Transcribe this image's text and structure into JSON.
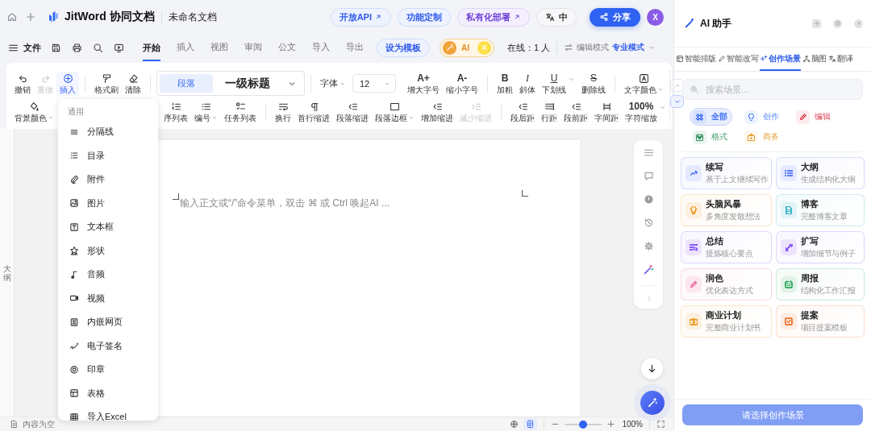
{
  "top_bar": {
    "app_name": "JitWord 协同文档",
    "doc_title": "未命名文档",
    "pills": [
      {
        "label": "开放API",
        "kind": "link"
      },
      {
        "label": "功能定制",
        "kind": "plain"
      },
      {
        "label": "私有化部署",
        "kind": "premium"
      }
    ],
    "language": "中",
    "share": "分享",
    "avatar": "X"
  },
  "menu_bar": {
    "file": "文件",
    "tabs": [
      {
        "label": "开始",
        "selected": true
      },
      {
        "label": "插入",
        "selected": false
      },
      {
        "label": "视图",
        "selected": false
      },
      {
        "label": "审阅",
        "selected": false
      },
      {
        "label": "公文",
        "selected": false
      },
      {
        "label": "导入",
        "selected": false
      },
      {
        "label": "导出",
        "selected": false
      }
    ],
    "template": "设为模板",
    "ai": {
      "label": "AI",
      "badge": "X"
    },
    "online": "在线：1 人",
    "mode_label": "编辑模式",
    "mode_value": "专业模式"
  },
  "toolbar": {
    "rows": [
      {
        "items": [
          {
            "kind": "button",
            "label": "撤销",
            "disabled": false,
            "active": false
          },
          {
            "kind": "button",
            "label": "重做",
            "disabled": true,
            "active": false
          },
          {
            "kind": "button",
            "label": "插入",
            "disabled": false,
            "active": true
          },
          {
            "kind": "divider"
          },
          {
            "kind": "button",
            "label": "格式刷",
            "disabled": false,
            "active": false
          },
          {
            "kind": "button",
            "label": "清除",
            "disabled": false,
            "active": false
          },
          {
            "kind": "divider"
          },
          {
            "kind": "style-picker",
            "options": [
              {
                "label": "段落",
                "selected": true
              },
              {
                "label": "一级标题",
                "selected": false
              }
            ]
          },
          {
            "kind": "divider"
          },
          {
            "kind": "font-picker",
            "label": "字体"
          },
          {
            "kind": "size-field",
            "value": "12"
          },
          {
            "kind": "bold-glyph",
            "glyph": "A+",
            "label": "增大字号",
            "disabled": false,
            "active": false
          },
          {
            "kind": "bold-glyph",
            "glyph": "A-",
            "label": "缩小字号",
            "disabled": false,
            "active": false
          },
          {
            "kind": "divider"
          },
          {
            "kind": "bold-glyph",
            "glyph": "B",
            "label": "加粗",
            "disabled": false,
            "active": false
          },
          {
            "kind": "italic-glyph",
            "glyph": "I",
            "label": "斜体",
            "disabled": false,
            "active": false
          },
          {
            "kind": "underline-glyph",
            "glyph": "U",
            "label": "下划线",
            "disabled": false,
            "active": false
          },
          {
            "kind": "caret"
          },
          {
            "kind": "strike-glyph",
            "glyph": "S",
            "label": "删除线",
            "disabled": false,
            "active": false
          },
          {
            "kind": "divider"
          },
          {
            "kind": "button",
            "label": "文字颜色",
            "disabled": false,
            "active": false,
            "dropdown": true
          }
        ]
      },
      {
        "items": [
          {
            "kind": "button",
            "label": "背景颜色",
            "disabled": false,
            "active": false,
            "dropdown": true
          },
          {
            "kind": "button",
            "label": "序列表",
            "disabled": false,
            "active": false
          },
          {
            "kind": "button",
            "label": "编号",
            "disabled": false,
            "active": false,
            "dropdown": true
          },
          {
            "kind": "button",
            "label": "任务列表",
            "disabled": false,
            "active": false
          },
          {
            "kind": "divider"
          },
          {
            "kind": "button",
            "label": "换行",
            "disabled": false,
            "active": false
          },
          {
            "kind": "button",
            "label": "首行缩进",
            "disabled": false,
            "active": false
          },
          {
            "kind": "button",
            "label": "段落缩进",
            "disabled": false,
            "active": false
          },
          {
            "kind": "button",
            "label": "段落边框",
            "disabled": false,
            "active": false,
            "dropdown": true
          },
          {
            "kind": "button",
            "label": "增加缩进",
            "disabled": false,
            "active": false
          },
          {
            "kind": "button",
            "label": "减少缩进",
            "disabled": true,
            "active": false
          },
          {
            "kind": "divider"
          },
          {
            "kind": "button",
            "label": "段后距",
            "disabled": false,
            "active": false
          },
          {
            "kind": "button",
            "label": "行距",
            "disabled": false,
            "active": false
          },
          {
            "kind": "button",
            "label": "段前距",
            "disabled": false,
            "active": false
          },
          {
            "kind": "button",
            "label": "字间距",
            "disabled": false,
            "active": false
          },
          {
            "kind": "bold-glyph",
            "glyph": "100%",
            "label": "字符缩放",
            "disabled": false,
            "active": false
          },
          {
            "kind": "caret"
          }
        ]
      }
    ]
  },
  "insert_menu": {
    "heading": "通用",
    "items": [
      "分隔线",
      "目录",
      "附件",
      "图片",
      "文本框",
      "形状",
      "音频",
      "视频",
      "内嵌网页",
      "电子签名",
      "印章",
      "表格",
      "导入Excel"
    ]
  },
  "outline_label": "大纲",
  "editor": {
    "placeholder": "输入正文或“/”命令菜单，双击 ⌘ 或 Ctrl 唤起AI ..."
  },
  "status_bar": {
    "status": "内容为空",
    "view_modes": [
      {
        "selected": false
      },
      {
        "selected": true
      }
    ],
    "zoom": {
      "level": 0.5
    },
    "zoom_label": "100%"
  },
  "ai_panel": {
    "title": "AI 助手",
    "tabs": [
      {
        "label": "智能排版",
        "selected": false
      },
      {
        "label": "智能改写",
        "selected": false
      },
      {
        "label": "创作场景",
        "selected": true
      },
      {
        "label": "脑图",
        "selected": false
      },
      {
        "label": "翻译",
        "selected": false
      }
    ],
    "search": {
      "placeholder": "搜索场景..."
    },
    "filters": [
      {
        "label": "全部",
        "selected": true,
        "color": "#3b6cf6"
      },
      {
        "label": "创作",
        "selected": false,
        "color": "#5b8cf5"
      },
      {
        "label": "编辑",
        "selected": false,
        "color": "#e0475a"
      },
      {
        "label": "格式",
        "selected": false,
        "color": "#3c9a6a"
      },
      {
        "label": "商务",
        "selected": false,
        "color": "#e8a23b"
      }
    ],
    "scenes": [
      {
        "title": "续写",
        "desc": "基于上文继续写作",
        "color": "#5b7cf5"
      },
      {
        "title": "大纲",
        "desc": "生成结构化大纲",
        "color": "#5b7cf5"
      },
      {
        "title": "头脑风暴",
        "desc": "多角度发散想法",
        "color": "#f0a030"
      },
      {
        "title": "博客",
        "desc": "完整博客文章",
        "color": "#3fb5c8"
      },
      {
        "title": "总结",
        "desc": "提炼核心要点",
        "color": "#8b5cf6"
      },
      {
        "title": "扩写",
        "desc": "增加细节与例子",
        "color": "#8b5cf6"
      },
      {
        "title": "润色",
        "desc": "优化表达方式",
        "color": "#ec6aa0"
      },
      {
        "title": "周报",
        "desc": "结构化工作汇报",
        "color": "#3fae6a"
      },
      {
        "title": "商业计划",
        "desc": "完整商业计划书",
        "color": "#f0a030"
      },
      {
        "title": "提案",
        "desc": "项目提案模板",
        "color": "#f08040"
      }
    ],
    "action": {
      "label": "请选择创作场景",
      "disabled": true
    }
  }
}
